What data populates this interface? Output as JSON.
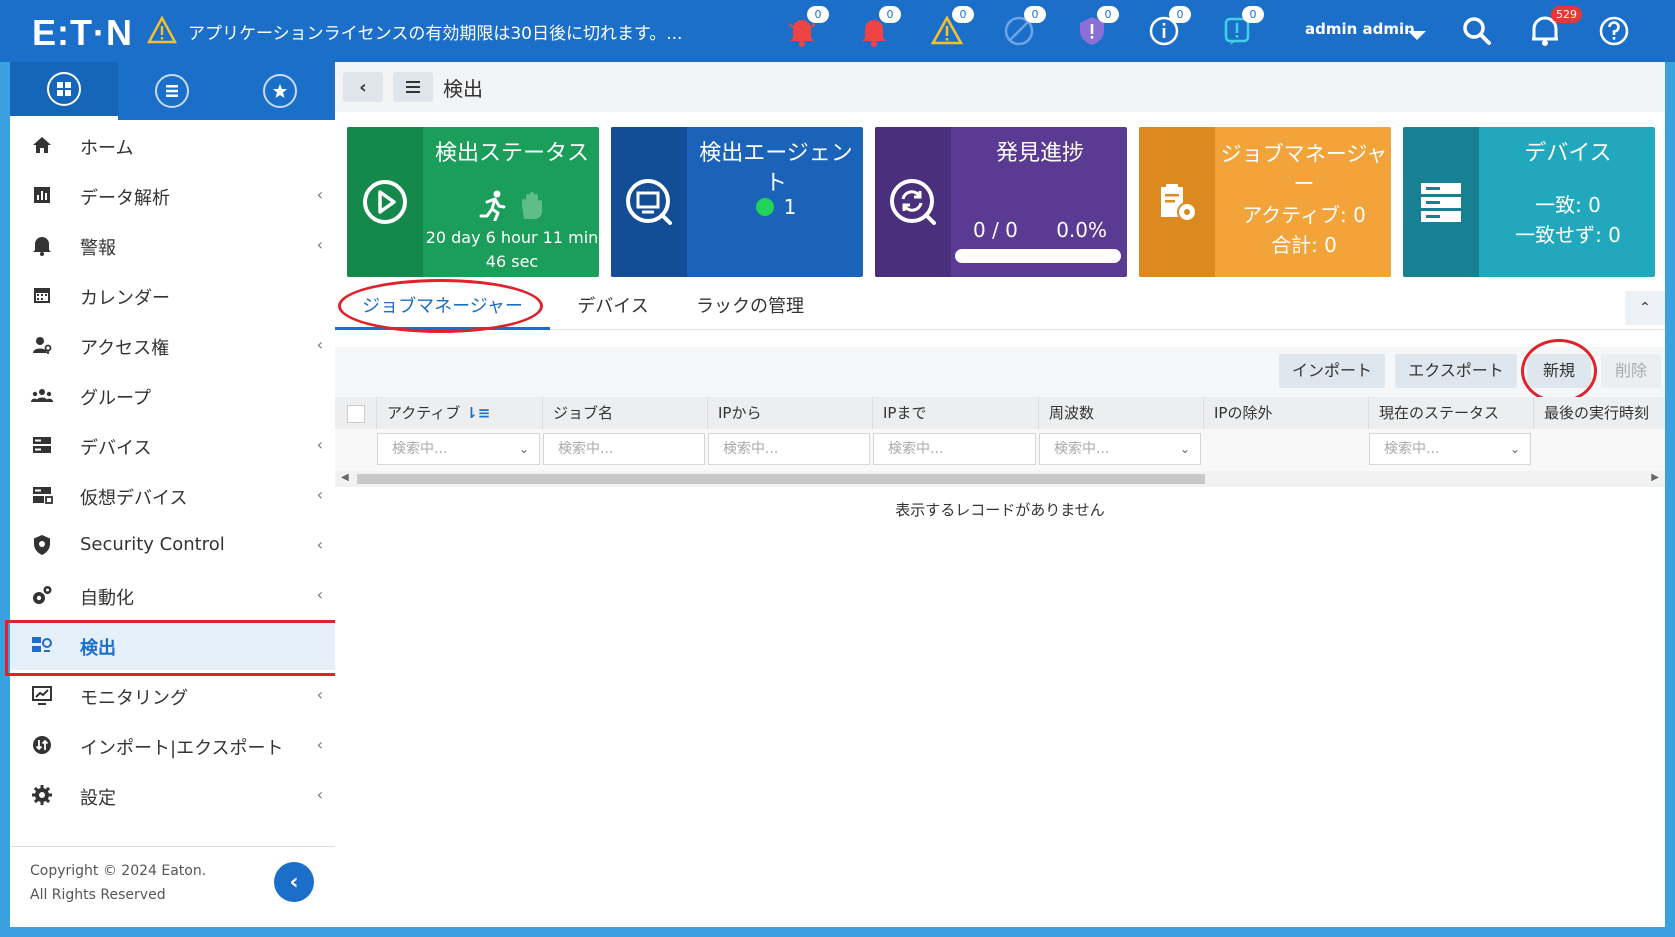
{
  "topbar": {
    "logo": "E:T·N",
    "license_warning": "アプリケーションライセンスの有効期限は30日後に切れます。...",
    "notifications": [
      {
        "icon": "bell-red-icon",
        "count": "0"
      },
      {
        "icon": "bell-red-icon",
        "count": "0"
      },
      {
        "icon": "warning-triangle-icon",
        "count": "0"
      },
      {
        "icon": "disabled-circle-icon",
        "count": "0"
      },
      {
        "icon": "shield-alert-icon",
        "count": "0"
      },
      {
        "icon": "info-circle-icon",
        "count": "0"
      },
      {
        "icon": "exclamation-box-icon",
        "count": "0"
      }
    ],
    "user": "admin admin",
    "inbox_count": "529"
  },
  "sidebar": {
    "items": [
      {
        "label": "ホーム",
        "icon": "home-icon",
        "chevron": ""
      },
      {
        "label": "データ解析",
        "icon": "bar-chart-icon",
        "chevron": "‹"
      },
      {
        "label": "警報",
        "icon": "bell-icon",
        "chevron": "‹"
      },
      {
        "label": "カレンダー",
        "icon": "calendar-icon",
        "chevron": ""
      },
      {
        "label": "アクセス権",
        "icon": "user-key-icon",
        "chevron": "‹"
      },
      {
        "label": "グループ",
        "icon": "users-icon",
        "chevron": ""
      },
      {
        "label": "デバイス",
        "icon": "server-icon",
        "chevron": "‹"
      },
      {
        "label": "仮想デバイス",
        "icon": "virtual-server-icon",
        "chevron": "‹"
      },
      {
        "label": "Security Control",
        "icon": "shield-icon",
        "chevron": "‹"
      },
      {
        "label": "自動化",
        "icon": "gears-icon",
        "chevron": "‹"
      },
      {
        "label": "検出",
        "icon": "discovery-icon",
        "chevron": ""
      },
      {
        "label": "モニタリング",
        "icon": "monitor-chart-icon",
        "chevron": "‹"
      },
      {
        "label": "インポート|エクスポート",
        "icon": "import-export-icon",
        "chevron": "‹"
      },
      {
        "label": "設定",
        "icon": "gear-icon",
        "chevron": "‹"
      }
    ],
    "copyright_line1": "Copyright © 2024 Eaton.",
    "copyright_line2": "All Rights Reserved"
  },
  "page": {
    "title": "検出"
  },
  "cards": {
    "status": {
      "title": "検出ステータス",
      "duration_line1": "20 day 6 hour 11 min",
      "duration_line2": "46 sec",
      "color": "#1a9e5a",
      "strip": "#15884c"
    },
    "agent": {
      "title": "検出エージェント",
      "count": "1",
      "color": "#1a63b8",
      "strip": "#134d96"
    },
    "progress": {
      "title": "発見進捗",
      "fraction": "0 / 0",
      "percent": "0.0%",
      "value": 0,
      "color": "#5a3a93",
      "strip": "#4a2f7c"
    },
    "job_manager": {
      "title": "ジョブマネージャー",
      "active": "アクティブ: 0",
      "total": "合計: 0",
      "color": "#f2a33a",
      "strip": "#dc8a1f"
    },
    "devices": {
      "title": "デバイス",
      "match": "一致: 0",
      "mismatch": "一致せず: 0",
      "color": "#21a8bd",
      "strip": "#178193"
    }
  },
  "tabs": [
    "ジョブマネージャー",
    "デバイス",
    "ラックの管理"
  ],
  "toolbar": {
    "import": "インポート",
    "export": "エクスポート",
    "new": "新規",
    "delete": "削除"
  },
  "table": {
    "columns": [
      "アクティブ",
      "ジョブ名",
      "IPから",
      "IPまで",
      "周波数",
      "IPの除外",
      "現在のステータス",
      "最後の実行時刻"
    ],
    "filter_placeholder": "検索中...",
    "empty_message": "表示するレコードがありません"
  }
}
